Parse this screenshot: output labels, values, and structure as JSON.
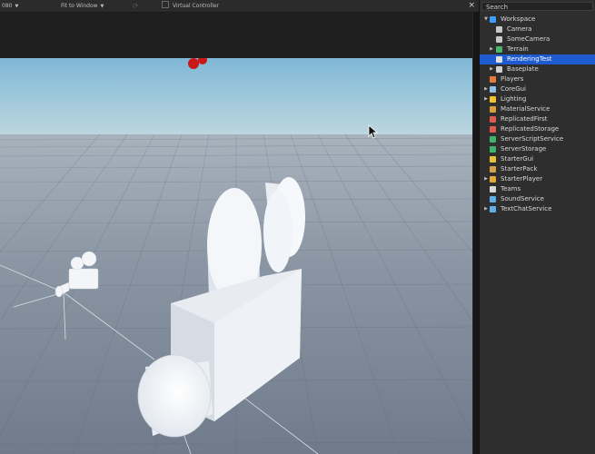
{
  "viewport": {
    "toolbar": {
      "resolution": "080",
      "view_mode": "Fit to Window",
      "virtual_controller": "Virtual Controller",
      "close": "×"
    }
  },
  "explorer": {
    "search_label": "Search",
    "items": [
      {
        "label": "Workspace",
        "icon": "workspace-icon",
        "color": "#3aa0ff",
        "depth": 0,
        "arrow": "▼",
        "selected": false
      },
      {
        "label": "Camera",
        "icon": "camera-icon",
        "color": "#c8c8c8",
        "depth": 1,
        "arrow": "",
        "selected": false
      },
      {
        "label": "SomeCamera",
        "icon": "camera-icon",
        "color": "#c8c8c8",
        "depth": 1,
        "arrow": "",
        "selected": false
      },
      {
        "label": "Terrain",
        "icon": "terrain-icon",
        "color": "#47b86a",
        "depth": 1,
        "arrow": "▶",
        "selected": false
      },
      {
        "label": "RenderingTest",
        "icon": "model-icon",
        "color": "#e0e0e0",
        "depth": 1,
        "arrow": "",
        "selected": true
      },
      {
        "label": "Baseplate",
        "icon": "part-icon",
        "color": "#cfcfcf",
        "depth": 1,
        "arrow": "▶",
        "selected": false
      },
      {
        "label": "Players",
        "icon": "players-icon",
        "color": "#e57b3c",
        "depth": 0,
        "arrow": "",
        "selected": false
      },
      {
        "label": "CoreGui",
        "icon": "gui-icon",
        "color": "#8ec0e8",
        "depth": 0,
        "arrow": "▶",
        "selected": false
      },
      {
        "label": "Lighting",
        "icon": "lighting-icon",
        "color": "#f2c230",
        "depth": 0,
        "arrow": "▶",
        "selected": false
      },
      {
        "label": "MaterialService",
        "icon": "material-service-icon",
        "color": "#d9a23f",
        "depth": 0,
        "arrow": "",
        "selected": false
      },
      {
        "label": "ReplicatedFirst",
        "icon": "replicated-first-icon",
        "color": "#e05a4d",
        "depth": 0,
        "arrow": "",
        "selected": false
      },
      {
        "label": "ReplicatedStorage",
        "icon": "replicated-storage-icon",
        "color": "#e05a4d",
        "depth": 0,
        "arrow": "",
        "selected": false
      },
      {
        "label": "ServerScriptService",
        "icon": "server-script-service-icon",
        "color": "#40b36b",
        "depth": 0,
        "arrow": "",
        "selected": false
      },
      {
        "label": "ServerStorage",
        "icon": "server-storage-icon",
        "color": "#40b36b",
        "depth": 0,
        "arrow": "",
        "selected": false
      },
      {
        "label": "StarterGui",
        "icon": "starter-gui-icon",
        "color": "#e9c23a",
        "depth": 0,
        "arrow": "",
        "selected": false
      },
      {
        "label": "StarterPack",
        "icon": "starter-pack-icon",
        "color": "#d4a24a",
        "depth": 0,
        "arrow": "",
        "selected": false
      },
      {
        "label": "StarterPlayer",
        "icon": "starter-player-icon",
        "color": "#e7a83a",
        "depth": 0,
        "arrow": "▶",
        "selected": false
      },
      {
        "label": "Teams",
        "icon": "teams-icon",
        "color": "#d8d8d8",
        "depth": 0,
        "arrow": "",
        "selected": false
      },
      {
        "label": "SoundService",
        "icon": "sound-service-icon",
        "color": "#5fb0e8",
        "depth": 0,
        "arrow": "",
        "selected": false
      },
      {
        "label": "TextChatService",
        "icon": "text-chat-service-icon",
        "color": "#5fb0e8",
        "depth": 0,
        "arrow": "▶",
        "selected": false
      }
    ]
  }
}
